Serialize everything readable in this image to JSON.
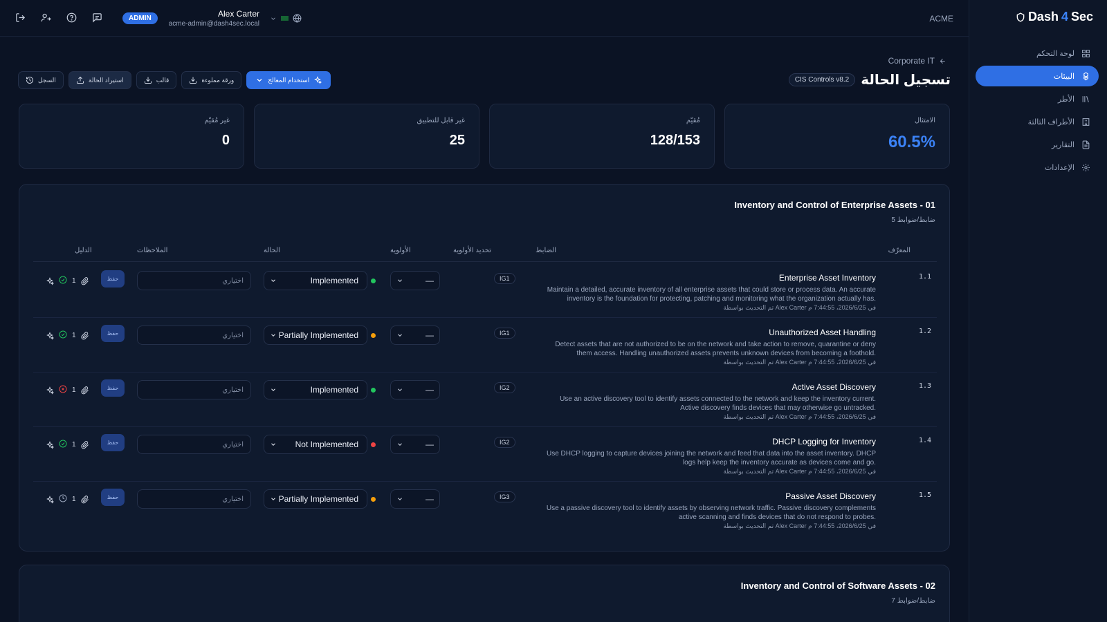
{
  "brand": {
    "name_a": "Dash",
    "name_b": "Sec",
    "bolt": "4"
  },
  "topbar": {
    "admin_badge": "ADMIN",
    "user_name": "Alex Carter",
    "user_email": "acme-admin@dash4sec.local",
    "tenant": "ACME"
  },
  "sidebar": {
    "items": [
      {
        "label": "لوحة التحكم",
        "icon": "grid-icon",
        "active": false
      },
      {
        "label": "البيئات",
        "icon": "cubes-icon",
        "active": true
      },
      {
        "label": "الأطر",
        "icon": "books-icon",
        "active": false
      },
      {
        "label": "الأطراف الثالثة",
        "icon": "building-icon",
        "active": false
      },
      {
        "label": "التقارير",
        "icon": "file-icon",
        "active": false
      },
      {
        "label": "الإعدادات",
        "icon": "gear-icon",
        "active": false
      }
    ]
  },
  "header": {
    "breadcrumb": "Corporate IT",
    "title": "تسجيل الحالة",
    "framework": "CIS Controls v8.2"
  },
  "actions": {
    "history": "السجل",
    "import_status": "استيراد الحالة",
    "template": "قالب",
    "filled_sheet": "ورقة مملوءة",
    "use_processor": "استخدام المعالج"
  },
  "stats": [
    {
      "label": "الامتثال",
      "value": "60.5%"
    },
    {
      "label": "مُقيّم",
      "value": "128/153"
    },
    {
      "label": "غير قابل للتطبيق",
      "value": "25"
    },
    {
      "label": "غير مُقيّم",
      "value": "0"
    }
  ],
  "table_headers": {
    "id": "المعرّف",
    "control": "الضابط",
    "prioritization": "تحديد الأولوية",
    "priority": "الأولوية",
    "status": "الحالة",
    "notes": "الملاحظات",
    "evidence": "الدليل"
  },
  "groups": [
    {
      "title": "Inventory and Control of Enterprise Assets - 01",
      "subtitle": "5 ضابط/ضوابط",
      "rows": [
        {
          "id": "1.1",
          "title": "Enterprise Asset Inventory",
          "desc1": "Maintain a detailed, accurate inventory of all enterprise assets that could store or process data. An accurate",
          "desc2": "inventory is the foundation for protecting, patching and monitoring what the organization actually has.",
          "updated": "تم التحديث بواسطة Alex Carter في 2026/6/25، 7:44:55 م",
          "ig": "IG1",
          "priority": "—",
          "status": "Implemented",
          "status_color": "#22c55e",
          "notes_placeholder": "اختياري",
          "save": "حفظ",
          "evidence_count": "1",
          "evidence_state": "check",
          "evidence_color": "#22c55e"
        },
        {
          "id": "1.2",
          "title": "Unauthorized Asset Handling",
          "desc1": "Detect assets that are not authorized to be on the network and take action to remove, quarantine or deny",
          "desc2": "them access. Handling unauthorized assets prevents unknown devices from becoming a foothold.",
          "updated": "تم التحديث بواسطة Alex Carter في 2026/6/25، 7:44:55 م",
          "ig": "IG1",
          "priority": "—",
          "status": "Partially Implemented",
          "status_color": "#f59e0b",
          "notes_placeholder": "اختياري",
          "save": "حفظ",
          "evidence_count": "1",
          "evidence_state": "check",
          "evidence_color": "#22c55e"
        },
        {
          "id": "1.3",
          "title": "Active Asset Discovery",
          "desc1": "Use an active discovery tool to identify assets connected to the network and keep the inventory current.",
          "desc2": "Active discovery finds devices that may otherwise go untracked.",
          "updated": "تم التحديث بواسطة Alex Carter في 2026/6/25، 7:44:55 م",
          "ig": "IG2",
          "priority": "—",
          "status": "Implemented",
          "status_color": "#22c55e",
          "notes_placeholder": "اختياري",
          "save": "حفظ",
          "evidence_count": "1",
          "evidence_state": "x",
          "evidence_color": "#ef4444"
        },
        {
          "id": "1.4",
          "title": "DHCP Logging for Inventory",
          "desc1": "Use DHCP logging to capture devices joining the network and feed that data into the asset inventory. DHCP",
          "desc2": "logs help keep the inventory accurate as devices come and go.",
          "updated": "تم التحديث بواسطة Alex Carter في 2026/6/25، 7:44:55 م",
          "ig": "IG2",
          "priority": "—",
          "status": "Not Implemented",
          "status_color": "#ef4444",
          "notes_placeholder": "اختياري",
          "save": "حفظ",
          "evidence_count": "1",
          "evidence_state": "check",
          "evidence_color": "#22c55e"
        },
        {
          "id": "1.5",
          "title": "Passive Asset Discovery",
          "desc1": "Use a passive discovery tool to identify assets by observing network traffic. Passive discovery complements",
          "desc2": "active scanning and finds devices that do not respond to probes.",
          "updated": "تم التحديث بواسطة Alex Carter في 2026/6/25، 7:44:55 م",
          "ig": "IG3",
          "priority": "—",
          "status": "Partially Implemented",
          "status_color": "#f59e0b",
          "notes_placeholder": "اختياري",
          "save": "حفظ",
          "evidence_count": "1",
          "evidence_state": "clock",
          "evidence_color": "#9aa6bd"
        }
      ]
    },
    {
      "title": "Inventory and Control of Software Assets - 02",
      "subtitle": "7 ضابط/ضوابط",
      "rows": []
    }
  ]
}
